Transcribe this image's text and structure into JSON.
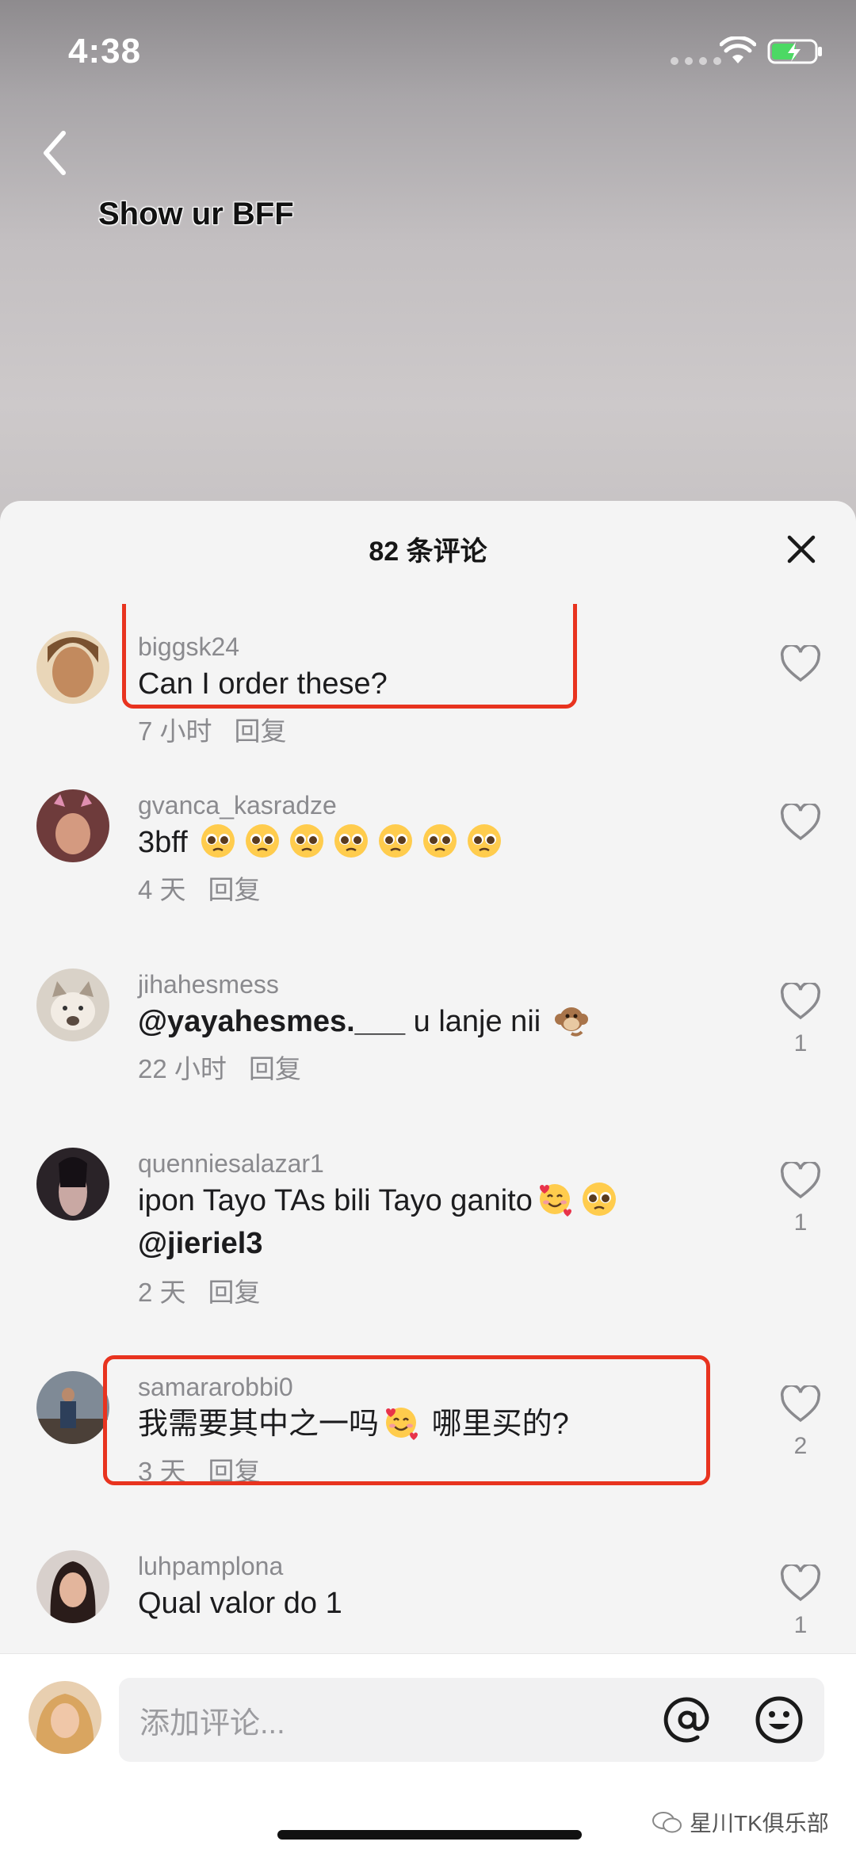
{
  "status_bar": {
    "time": "4:38"
  },
  "video": {
    "caption": "Show ur BFF"
  },
  "sheet": {
    "title": "82 条评论"
  },
  "comments": [
    {
      "username": "biggsk24",
      "text": "Can I order these?",
      "time": "7 小时",
      "reply": "回复",
      "likes": "",
      "highlighted": true,
      "avatar_color": "#c28a5e"
    },
    {
      "username": "gvanca_kasradze",
      "text": "3bff",
      "emoji": [
        "pleading-face",
        "pleading-face",
        "pleading-face",
        "pleading-face",
        "pleading-face",
        "pleading-face",
        "pleading-face"
      ],
      "time": "4 天",
      "reply": "回复",
      "likes": "",
      "highlighted": false,
      "avatar_color": "#a25a56"
    },
    {
      "username": "jihahesmess",
      "mention": "@yayahesmes.___",
      "text": " u lanje nii",
      "emoji": [
        "monkey-face"
      ],
      "time": "22 小时",
      "reply": "回复",
      "likes": "1",
      "highlighted": false,
      "avatar_color": "#cfc6bd"
    },
    {
      "username": "quenniesalazar1",
      "text": "ipon Tayo TAs bili Tayo ganito",
      "emoji": [
        "smiling-face-with-hearts",
        "pleading-face"
      ],
      "mention": "@jieriel3",
      "time": "2 天",
      "reply": "回复",
      "likes": "1",
      "highlighted": false,
      "avatar_color": "#3a2f35"
    },
    {
      "username": "samararobbi0",
      "text": "我需要其中之一吗",
      "emoji": [
        "smiling-face-with-hearts"
      ],
      "text_after": " 哪里买的?",
      "time": "3 天",
      "reply": "回复",
      "likes": "2",
      "highlighted": true,
      "avatar_color": "#5d6a7a"
    },
    {
      "username": "luhpamplona",
      "text": "Qual valor do 1",
      "time": "",
      "reply": "",
      "likes": "1",
      "highlighted": false,
      "avatar_color": "#3b2b28"
    }
  ],
  "input": {
    "placeholder": "添加评论..."
  },
  "watermark": "星川TK俱乐部",
  "colors": {
    "highlight": "#e8331f",
    "sheet_background": "#f4f4f4",
    "muted_text": "#8a8a8e"
  }
}
